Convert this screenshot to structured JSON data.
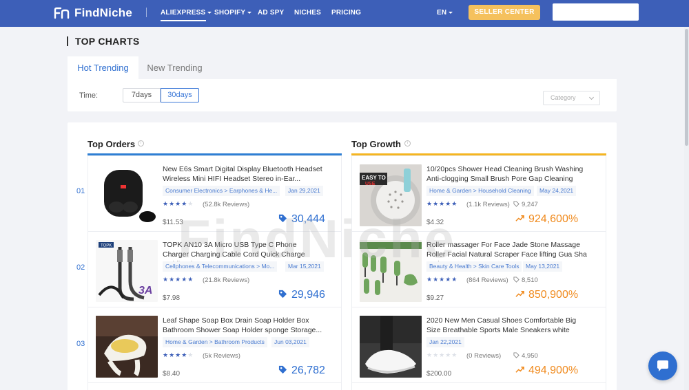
{
  "brand": {
    "name": "FindNiche"
  },
  "nav": {
    "items": [
      {
        "label": "ALIEXPRESS",
        "caret": true
      },
      {
        "label": "SHOPIFY",
        "caret": true
      },
      {
        "label": "AD SPY",
        "caret": false
      },
      {
        "label": "NICHES",
        "caret": false
      },
      {
        "label": "PRICING",
        "caret": false
      }
    ],
    "language": "EN",
    "seller_center": "SELLER CENTER"
  },
  "page": {
    "title": "TOP CHARTS"
  },
  "tabs": {
    "hot": "Hot Trending",
    "new": "New Trending"
  },
  "filters": {
    "time_label": "Time:",
    "periods": [
      "7days",
      "30days"
    ],
    "selected_period": "30days",
    "category_placeholder": "Category"
  },
  "watermark": "FindNiche",
  "top_orders": {
    "title": "Top Orders",
    "items": [
      {
        "rank": "01",
        "title": "New E6s Smart Digital Display Bluetooth Headset Wireless Mini HIFI Headset Stereo in-Ear...",
        "category": "Consumer Electronics > Earphones & He...",
        "date": "Jan 29,2021",
        "rating": 4.5,
        "reviews": "(52.8k Reviews)",
        "price": "$11.53",
        "orders": "30,444"
      },
      {
        "rank": "02",
        "title": "TOPK AN10 3A Micro USB Type C Phone Charger Charging Cable Cord Quick Charge Mobile Phone...",
        "category": "Cellphones & Telecommunications > Mo...",
        "date": "Mar 15,2021",
        "rating": 5,
        "reviews": "(21.8k Reviews)",
        "price": "$7.98",
        "orders": "29,946"
      },
      {
        "rank": "03",
        "title": "Leaf Shape Soap Box Drain Soap Holder Box Bathroom Shower Soap Holder sponge Storage...",
        "category": "Home & Garden > Bathroom Products",
        "date": "Jun 03,2021",
        "rating": 4.5,
        "reviews": "(5k Reviews)",
        "price": "$8.40",
        "orders": "26,782"
      }
    ]
  },
  "top_growth": {
    "title": "Top Growth",
    "items": [
      {
        "title": "10/20pcs Shower Head Cleaning Brush Washing Anti-clogging Small Brush Pore Gap Cleaning Brus...",
        "category": "Home & Garden > Household Cleaning",
        "date": "May 24,2021",
        "rating": 5,
        "reviews": "(1.1k Reviews)",
        "sales": "9,247",
        "price": "$4.32",
        "growth": "924,600%"
      },
      {
        "title": "Roller massager For Face Jade Stone Massage Roller Facial Natural Scraper Face lifting Gua Sha Body...",
        "category": "Beauty & Health > Skin Care Tools",
        "date": "May 13,2021",
        "rating": 5,
        "reviews": "(864 Reviews)",
        "sales": "8,510",
        "price": "$9.27",
        "growth": "850,900%"
      },
      {
        "title": "2020 New Men Casual Shoes Comfortable Big Size Breathable Sports Male Sneakers white",
        "category": "",
        "date": "Jan 22,2021",
        "rating": 0,
        "reviews": "(0 Reviews)",
        "sales": "4,950",
        "price": "$200.00",
        "growth": "494,900%"
      }
    ]
  },
  "colors": {
    "header": "#3d5fb8",
    "accent_blue": "#2f6fd0",
    "accent_orange": "#f08a1d",
    "seller_btn": "#f5c15d"
  },
  "icons": {
    "logo": "findniche-logo-icon",
    "info": "info-icon",
    "tag": "tag-icon",
    "trend": "trend-up-icon",
    "chat": "chat-icon"
  }
}
